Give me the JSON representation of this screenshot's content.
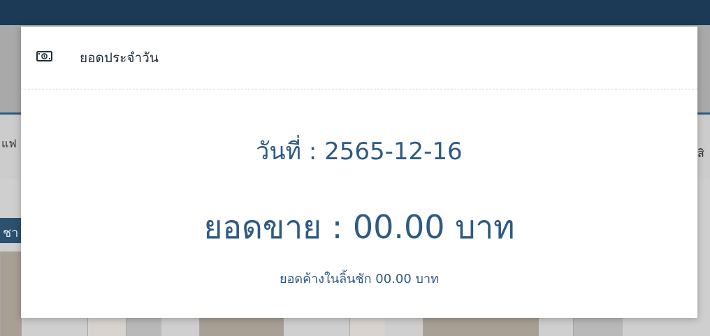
{
  "modal": {
    "title": "ยอดประจำวัน",
    "icon": "cash-icon",
    "date_label": "วันที่ : 2565-12-16",
    "sales_label": "ยอดขาย : 00.00 บาท",
    "drawer_label": "ยอดค้างในลิ้นชัก 00.00 บาท"
  },
  "background": {
    "row_left_text": "แฟ",
    "row_right_text": "สิ",
    "category_text": "ชา"
  },
  "colors": {
    "topbar": "#1c3a55",
    "accent_text": "#2e5a85",
    "modal_bg": "#ffffff",
    "overlay_bg": "#cfcfcf"
  }
}
